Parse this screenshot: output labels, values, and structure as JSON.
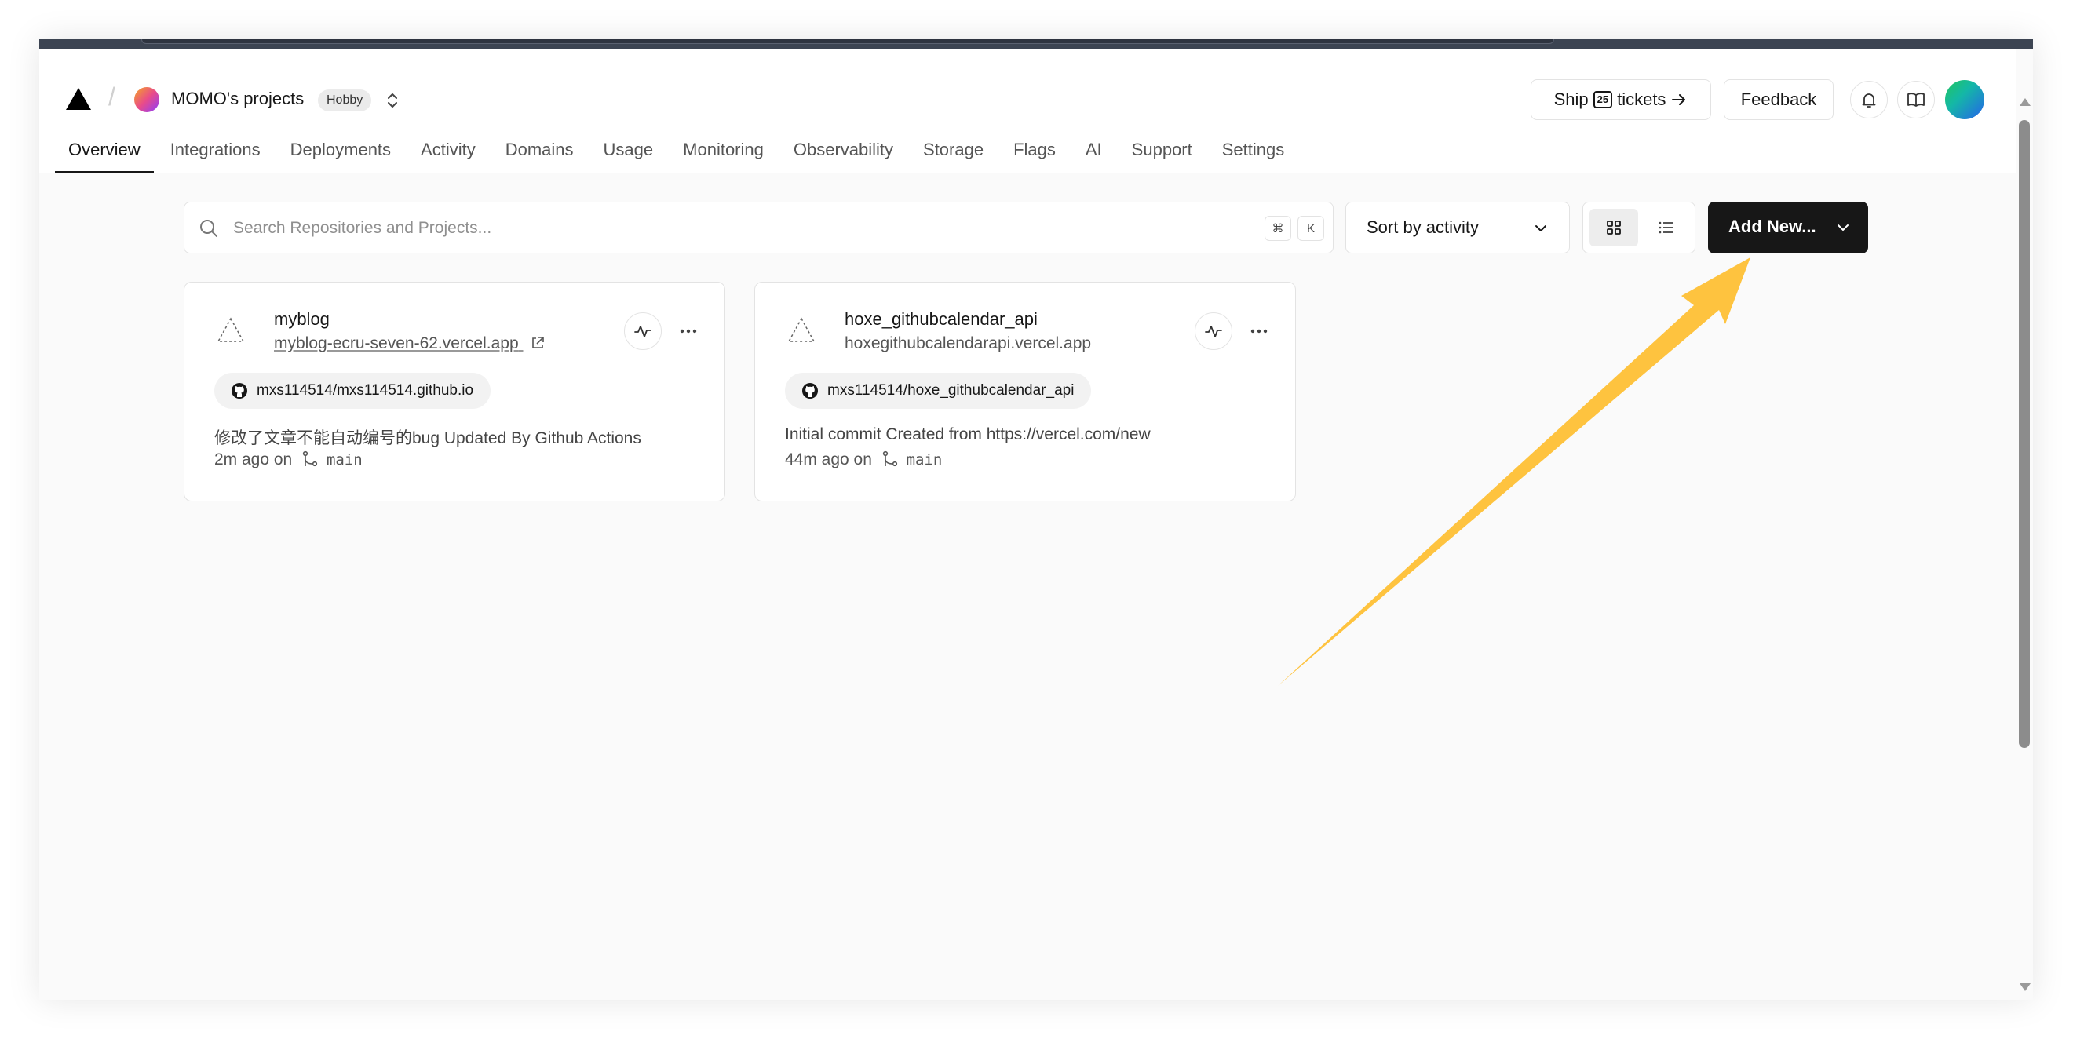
{
  "header": {
    "team_name": "MOMO's projects",
    "plan_badge": "Hobby",
    "ship_label_before": "Ship",
    "ship_badge": "25",
    "ship_label_after": "tickets",
    "feedback_label": "Feedback"
  },
  "tabs": [
    {
      "label": "Overview",
      "active": true
    },
    {
      "label": "Integrations"
    },
    {
      "label": "Deployments"
    },
    {
      "label": "Activity"
    },
    {
      "label": "Domains"
    },
    {
      "label": "Usage"
    },
    {
      "label": "Monitoring"
    },
    {
      "label": "Observability"
    },
    {
      "label": "Storage"
    },
    {
      "label": "Flags"
    },
    {
      "label": "AI"
    },
    {
      "label": "Support"
    },
    {
      "label": "Settings"
    }
  ],
  "toolbar": {
    "search_placeholder": "Search Repositories and Projects...",
    "kbd_cmd": "⌘",
    "kbd_k": "K",
    "sort_label": "Sort by activity",
    "add_new_label": "Add New..."
  },
  "projects": [
    {
      "name": "myblog",
      "url": "myblog-ecru-seven-62.vercel.app",
      "repo": "mxs114514/mxs114514.github.io",
      "commit_message": "修改了文章不能自动编号的bug Updated By Github Actions",
      "time_ago": "2m ago on",
      "branch": "main"
    },
    {
      "name": "hoxe_githubcalendar_api",
      "url": "hoxegithubcalendarapi.vercel.app",
      "repo": "mxs114514/hoxe_githubcalendar_api",
      "commit_message": "Initial commit Created from https://vercel.com/new",
      "time_ago": "44m ago on",
      "branch": "main"
    }
  ],
  "colors": {
    "accent": "#171717",
    "annotation_arrow": "#fec33f"
  }
}
